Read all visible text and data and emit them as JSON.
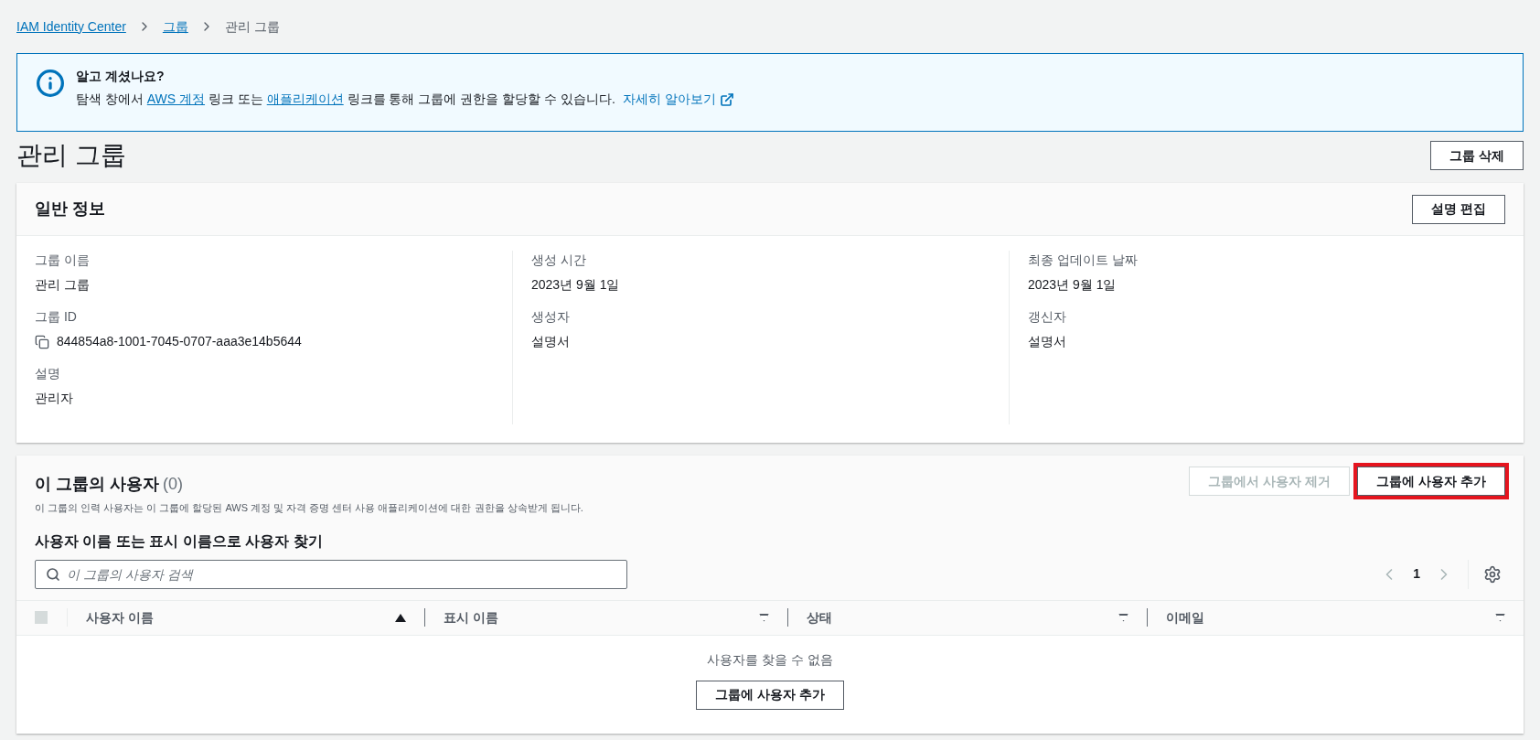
{
  "breadcrumb": [
    {
      "label": "IAM Identity Center",
      "kind": "link"
    },
    {
      "label": "그룹",
      "kind": "link"
    },
    {
      "label": "관리 그룹",
      "kind": "current"
    }
  ],
  "info": {
    "title": "알고 계셨나요?",
    "parts": [
      {
        "text": "탐색 창에서 ",
        "kind": "text"
      },
      {
        "text": "AWS 계정",
        "kind": "link"
      },
      {
        "text": " 링크 또는 ",
        "kind": "text"
      },
      {
        "text": "애플리케이션",
        "kind": "link"
      },
      {
        "text": " 링크를 통해 그룹에 권한을 할당할 수 있습니다.",
        "kind": "text"
      }
    ],
    "learn_more": "자세히 알아보기"
  },
  "page_title": "관리 그룹",
  "delete_button": "그룹 삭제",
  "general": {
    "title": "일반 정보",
    "edit_button": "설명 편집",
    "columns": [
      [
        {
          "label": "그룹 이름",
          "value": "관리 그룹",
          "copy": false
        },
        {
          "label": "그룹 ID",
          "value": "844854a8-1001-7045-0707-aaa3e14b5644",
          "copy": true
        },
        {
          "label": "설명",
          "value": "관리자",
          "copy": false
        }
      ],
      [
        {
          "label": "생성 시간",
          "value": "2023년 9월 1일",
          "copy": false
        },
        {
          "label": "생성자",
          "value": "설명서",
          "copy": false
        }
      ],
      [
        {
          "label": "최종 업데이트 날짜",
          "value": "2023년 9월 1일",
          "copy": false
        },
        {
          "label": "갱신자",
          "value": "설명서",
          "copy": false
        }
      ]
    ]
  },
  "users": {
    "title": "이 그룹의 사용자",
    "count": "(0)",
    "description": "이 그룹의 인력 사용자는 이 그룹에 할당된 AWS 계정 및 자격 증명 센터 사용 애플리케이션에 대한 권한을 상속받게 됩니다.",
    "buttons": [
      {
        "label": "그룹에서 사용자 제거",
        "disabled": true,
        "highlighted": false
      },
      {
        "label": "그룹에 사용자 추가",
        "disabled": false,
        "highlighted": true
      }
    ],
    "search_label": "사용자 이름 또는 표시 이름으로 사용자 찾기",
    "search": {
      "placeholder": "이 그룹의 사용자 검색"
    },
    "page": "1",
    "columns": [
      {
        "label": "사용자 이름",
        "sorted": true
      },
      {
        "label": "표시 이름",
        "sorted": false
      },
      {
        "label": "상태",
        "sorted": false
      },
      {
        "label": "이메일",
        "sorted": false
      }
    ],
    "select_all": {
      "checked": false
    },
    "empty_text": "사용자를 찾을 수 없음",
    "empty_button": "그룹에 사용자 추가"
  }
}
